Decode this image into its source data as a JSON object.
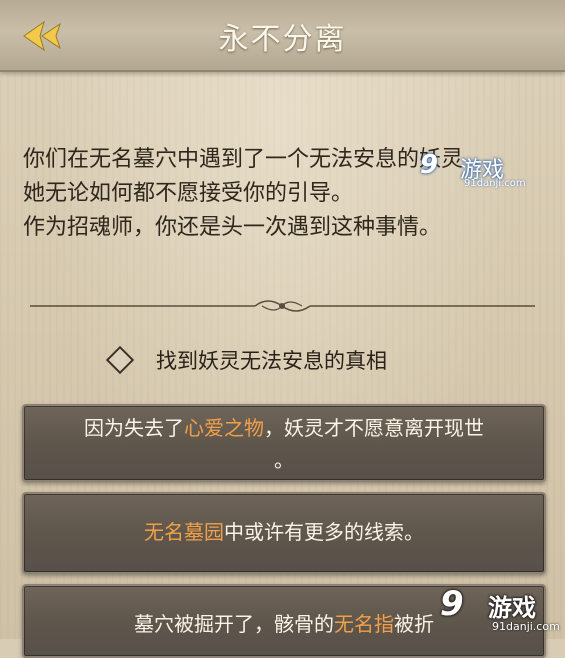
{
  "header": {
    "title": "永不分离",
    "back_icon": "double-chevron-left-icon",
    "accent_color": "#f2c94c"
  },
  "intro": {
    "line1": "你们在无名墓穴中遇到了一个无法安息的妖灵",
    "line2": "她无论如何都不愿接受你的引导。",
    "line3": "作为招魂师，你还是头一次遇到这种事情。"
  },
  "objective": {
    "icon": "diamond-icon",
    "text": "找到妖灵无法安息的真相"
  },
  "options": [
    {
      "pre": "因为失去了",
      "highlight": "心爱之物",
      "post": "，妖灵才不愿意离开现世",
      "line2": "。"
    },
    {
      "pre": "",
      "highlight": "无名墓园",
      "post": "中或许有更多的线索。"
    },
    {
      "pre": "墓穴被掘开了，骸骨的",
      "highlight": "无名指",
      "post": "被折"
    }
  ],
  "highlight_color": "#f0a04a",
  "watermark_top": {
    "num": "9",
    "text": "游戏",
    "url": "91danji.com"
  },
  "watermark_bottom": {
    "num": "9",
    "text": "游戏",
    "url": "91danji.com"
  }
}
